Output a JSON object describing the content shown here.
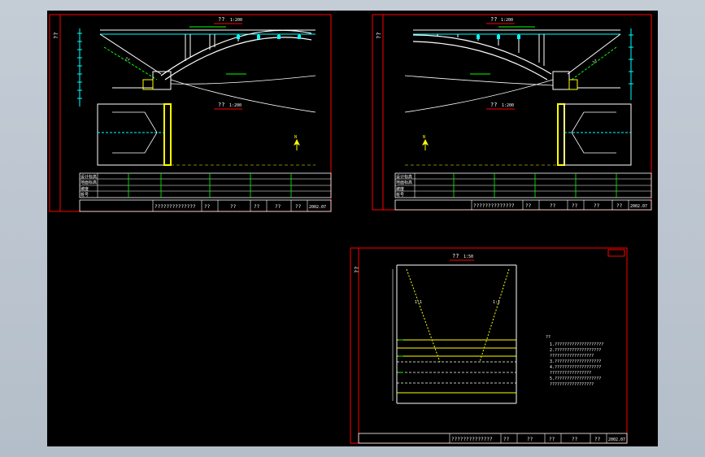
{
  "colors": {
    "background": "#000000",
    "frame": "#ff0000",
    "line": "#ffffff",
    "dim": "#00ff00",
    "accent": "#00ffff",
    "highlight": "#ffff00",
    "hatch": "#ff00ff"
  },
  "sheet_left": {
    "corner_code": "??",
    "elevation_title": "??",
    "elevation_scale": "1:200",
    "plan_title": "??",
    "plan_scale": "1:200",
    "north_arrow_label": "N",
    "table_rows": [
      "设计标高",
      "地面标高",
      "坡度",
      "桩号"
    ],
    "title_block": [
      "??????????????",
      "??",
      "??",
      "??",
      "??",
      "??",
      "2002.07"
    ]
  },
  "sheet_right": {
    "corner_code": "??",
    "elevation_title": "??",
    "elevation_scale": "1:200",
    "plan_title": "??",
    "plan_scale": "1:200",
    "north_arrow_label": "N",
    "table_rows": [
      "设计标高",
      "地面标高",
      "坡度",
      "桩号"
    ],
    "title_block": [
      "??????????????",
      "??",
      "??",
      "??",
      "??",
      "??",
      "2002.07"
    ]
  },
  "sheet_bottom": {
    "corner_code": "??",
    "section_title": "??",
    "section_scale": "1:50",
    "notes_heading": "??",
    "notes": [
      "1.????????????????????",
      "2.???????????????????",
      "  ??????????????????",
      "3.???????????????????",
      "4.???????????????????",
      "  ?????????????????",
      "5.???????????????????",
      "  ??????????????????"
    ],
    "title_block": [
      "??????????????",
      "??",
      "??",
      "??",
      "??",
      "??",
      "2002.07"
    ]
  }
}
